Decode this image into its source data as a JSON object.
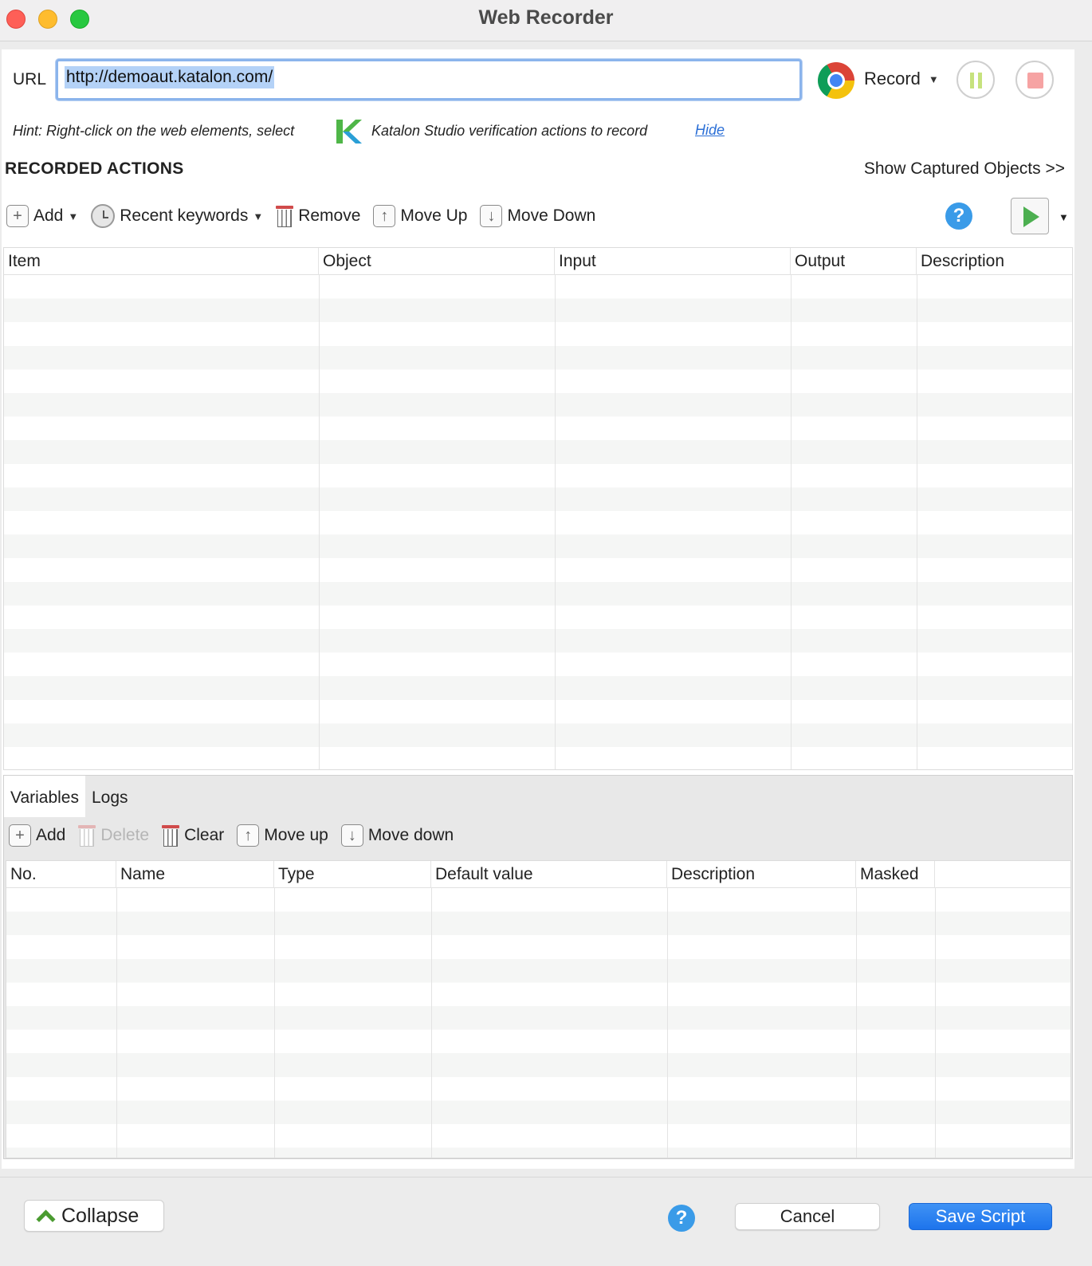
{
  "window": {
    "title": "Web Recorder"
  },
  "url_bar": {
    "label": "URL",
    "value": "http://demoaut.katalon.com/"
  },
  "recorder": {
    "browser_icon": "chrome-icon",
    "record_label": "Record"
  },
  "hint": {
    "text_before": "Hint: Right-click on the web elements, select",
    "text_after": "Katalon Studio verification actions to record",
    "hide_label": "Hide"
  },
  "recorded_actions": {
    "title": "RECORDED ACTIONS",
    "show_captured_label": "Show Captured Objects >>",
    "toolbar": {
      "add": "Add",
      "recent_keywords": "Recent keywords",
      "remove": "Remove",
      "move_up": "Move Up",
      "move_down": "Move Down"
    },
    "columns": [
      "Item",
      "Object",
      "Input",
      "Output",
      "Description"
    ]
  },
  "bottom_tabs": [
    "Variables",
    "Logs"
  ],
  "variables": {
    "toolbar": {
      "add": "Add",
      "delete": "Delete",
      "clear": "Clear",
      "move_up": "Move up",
      "move_down": "Move down"
    },
    "columns": [
      "No.",
      "Name",
      "Type",
      "Default value",
      "Description",
      "Masked"
    ]
  },
  "footer": {
    "collapse": "Collapse",
    "cancel": "Cancel",
    "save": "Save Script"
  },
  "colors": {
    "accent": "#1d74ec",
    "help": "#3a9be8",
    "play": "#4caf50",
    "link": "#2b6fd6"
  }
}
